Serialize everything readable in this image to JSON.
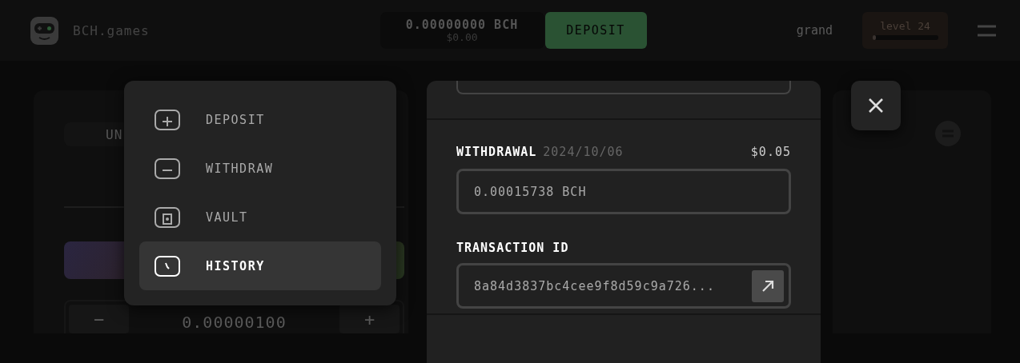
{
  "header": {
    "brand": "BCH.games",
    "balance": {
      "amount": "0.00000000 BCH",
      "usd": "$0.00"
    },
    "deposit_button": "DEPOSIT",
    "username": "grand",
    "level": {
      "label": "level 24",
      "level": 0.03
    }
  },
  "background": {
    "tab_label": "UN",
    "stepper": {
      "minus": "−",
      "value": "0.00000100",
      "plus": "+"
    }
  },
  "menu": {
    "items": [
      {
        "label": "DEPOSIT",
        "kind": "plus",
        "selected": false
      },
      {
        "label": "WITHDRAW",
        "kind": "minus",
        "selected": false
      },
      {
        "label": "VAULT",
        "kind": "vault",
        "selected": false
      },
      {
        "label": "HISTORY",
        "kind": "clock",
        "selected": true
      }
    ]
  },
  "modal": {
    "transaction": {
      "type": "WITHDRAWAL",
      "date": "2024/10/06",
      "usd": "$0.05",
      "amount": "0.00015738 BCH",
      "id_label": "TRANSACTION ID",
      "id": "8a84d3837bc4cee9f8d59c9a726..."
    }
  }
}
